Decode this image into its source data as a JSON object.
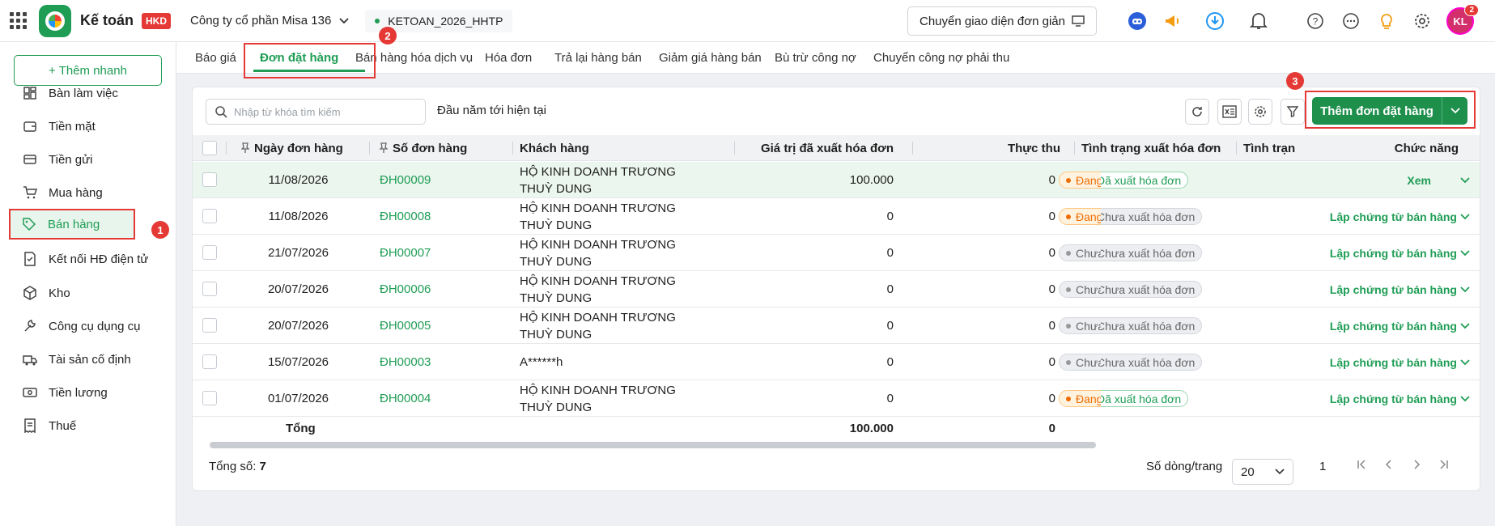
{
  "app": {
    "name": "Kế toán",
    "badge": "HKD",
    "company": "Công ty cổ phần Misa 136",
    "database": "KETOAN_2026_HHTP",
    "switch_ui": "Chuyển giao diện đơn giản",
    "avatar": "KL",
    "notif_count": "2"
  },
  "sidebar": {
    "add_quick": "+ Thêm nhanh",
    "items": [
      {
        "label": "Bàn làm việc",
        "icon": "dashboard-icon"
      },
      {
        "label": "Tiền mặt",
        "icon": "wallet-icon"
      },
      {
        "label": "Tiền gửi",
        "icon": "bank-card-icon"
      },
      {
        "label": "Mua hàng",
        "icon": "cart-icon"
      },
      {
        "label": "Bán hàng",
        "icon": "tag-icon"
      },
      {
        "label": "Kết nối HĐ điện tử",
        "icon": "e-invoice-icon"
      },
      {
        "label": "Kho",
        "icon": "box-icon"
      },
      {
        "label": "Công cụ dụng cụ",
        "icon": "tools-icon"
      },
      {
        "label": "Tài sản cố định",
        "icon": "truck-icon"
      },
      {
        "label": "Tiền lương",
        "icon": "money-icon"
      },
      {
        "label": "Thuế",
        "icon": "receipt-icon"
      }
    ]
  },
  "callouts": {
    "one": "1",
    "two": "2",
    "three": "3"
  },
  "tabs": [
    "Báo giá",
    "Đơn đặt hàng",
    "Bán hàng hóa dịch vụ",
    "Hóa đơn",
    "Trả lại hàng bán",
    "Giảm giá hàng bán",
    "Bù trừ công nợ",
    "Chuyển công nợ phải thu"
  ],
  "toolbar": {
    "search_placeholder": "Nhập từ khóa tìm kiếm",
    "period": "Đầu năm tới hiện tại",
    "add_order": "Thêm đơn đặt hàng"
  },
  "table": {
    "headers": {
      "date": "Ngày đơn hàng",
      "number": "Số đơn hàng",
      "customer": "Khách hàng",
      "invoiced": "Giá trị đã xuất hóa đơn",
      "collected": "Thực thu",
      "invoice_status": "Tình trạng xuất hóa đơn",
      "status": "Tình trạn",
      "action": "Chức năng"
    },
    "rows": [
      {
        "date": "11/08/2026",
        "number": "ĐH00009",
        "customer": "HỘ KINH DOANH TRƯƠNG THUỲ DUNG",
        "invoiced": "100.000",
        "collected": "0",
        "invoice_status": "Đã xuất hóa đơn",
        "status": "Đang",
        "action": "Xem"
      },
      {
        "date": "11/08/2026",
        "number": "ĐH00008",
        "customer": "HỘ KINH DOANH TRƯƠNG THUỲ DUNG",
        "invoiced": "0",
        "collected": "0",
        "invoice_status": "Chưa xuất hóa đơn",
        "status": "Đang",
        "action": "Lập chứng từ bán hàng"
      },
      {
        "date": "21/07/2026",
        "number": "ĐH00007",
        "customer": "HỘ KINH DOANH TRƯƠNG THUỲ DUNG",
        "invoiced": "0",
        "collected": "0",
        "invoice_status": "Chưa xuất hóa đơn",
        "status": "Chưa",
        "action": "Lập chứng từ bán hàng"
      },
      {
        "date": "20/07/2026",
        "number": "ĐH00006",
        "customer": "HỘ KINH DOANH TRƯƠNG THUỲ DUNG",
        "invoiced": "0",
        "collected": "0",
        "invoice_status": "Chưa xuất hóa đơn",
        "status": "Chưa",
        "action": "Lập chứng từ bán hàng"
      },
      {
        "date": "20/07/2026",
        "number": "ĐH00005",
        "customer": "HỘ KINH DOANH TRƯƠNG THUỲ DUNG",
        "invoiced": "0",
        "collected": "0",
        "invoice_status": "Chưa xuất hóa đơn",
        "status": "Chưa",
        "action": "Lập chứng từ bán hàng"
      },
      {
        "date": "15/07/2026",
        "number": "ĐH00003",
        "customer": "A******h",
        "invoiced": "0",
        "collected": "0",
        "invoice_status": "Chưa xuất hóa đơn",
        "status": "Chưa",
        "action": "Lập chứng từ bán hàng"
      },
      {
        "date": "01/07/2026",
        "number": "ĐH00004",
        "customer": "HỘ KINH DOANH TRƯƠNG THUỲ DUNG",
        "invoiced": "0",
        "collected": "0",
        "invoice_status": "Đã xuất hóa đơn",
        "status": "Đang",
        "action": "Lập chứng từ bán hàng"
      }
    ],
    "total": {
      "label": "Tổng",
      "invoiced": "100.000",
      "collected": "0"
    }
  },
  "footer": {
    "total_label": "Tổng số:",
    "total_count": "7",
    "rows_per_page_label": "Số dòng/trang",
    "rows_per_page": "20",
    "page": "1"
  },
  "colors": {
    "brand": "#1f9d55",
    "highlight": "#e53935"
  }
}
